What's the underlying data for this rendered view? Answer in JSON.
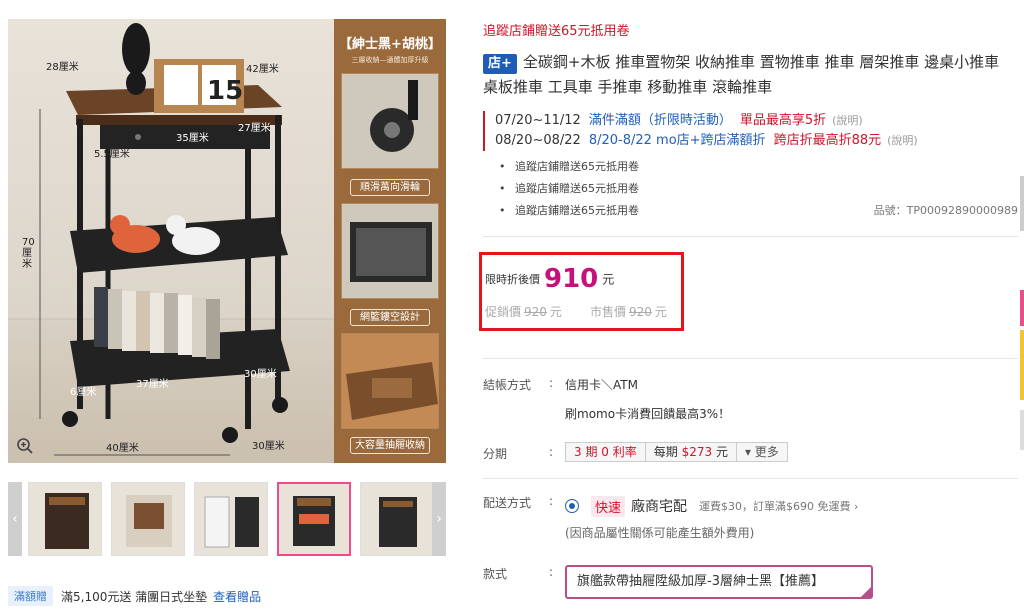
{
  "gallery": {
    "side_title": "【紳士黑+胡桃】",
    "side_subtitle": "三層收納—通體加厚升級",
    "side_labels": [
      "順滑萬向滑輪",
      "網籃鏤空設計",
      "大容量抽屜收納"
    ],
    "dimensions": {
      "top_left": "28厘米",
      "top_right": "42厘米",
      "drawer_w": "35厘米",
      "drawer_d": "27厘米",
      "drawer_h": "5.5厘米",
      "height": "70厘米",
      "wheel": "6厘米",
      "basket_w": "37厘米",
      "basket_d": "30厘米",
      "base_w": "40厘米",
      "base_d": "30厘米"
    },
    "zoom_icon": "zoom-in-icon",
    "prev_icon": "chevron-left-icon",
    "next_icon": "chevron-right-icon",
    "thumbnail_count": 5,
    "active_thumbnail": 4
  },
  "promo": {
    "tag": "滿額贈",
    "text": "滿5,100元送 蒲團日式坐墊",
    "link": "查看贈品"
  },
  "product": {
    "follow_text": "追蹤店鋪贈送65元抵用卷",
    "store_badge": "店+",
    "title": "全碳鋼+木板 推車置物架 收納推車 置物推車 推車 層架推車 邊桌小推車 桌板推車 工具車 手推車 移動推車 滾輪推車",
    "promotions": [
      {
        "date": "07/20~11/12",
        "text": "滿件滿額（折限時活動）",
        "highlight": "單品最高享5折",
        "note": "(說明)"
      },
      {
        "date": "08/20~08/22",
        "text": "8/20-8/22 mo店+跨店滿額折",
        "highlight": "跨店折最高折88元",
        "note": "(說明)"
      }
    ],
    "bullets": [
      "追蹤店鋪贈送65元抵用卷",
      "追蹤店鋪贈送65元抵用卷",
      "追蹤店鋪贈送65元抵用卷"
    ],
    "sku": "品號：TP00092890000989"
  },
  "price": {
    "label": "限時折後價",
    "value": "910",
    "unit": "元",
    "promo_label": "促銷價",
    "promo_value": "920",
    "market_label": "市售價",
    "market_value": "920"
  },
  "payment": {
    "label": "結帳方式",
    "colon": ":",
    "method": "信用卡＼ATM",
    "note": "刷momo卡消費回饋最高3%！"
  },
  "installment": {
    "label": "分期",
    "periods": "3 期 0 利率",
    "per_label": "每期",
    "per_amount": "$273",
    "per_unit": "元",
    "more": "▾ 更多"
  },
  "shipping": {
    "label": "配送方式",
    "quick": "快速",
    "name": "廠商宅配",
    "fee": "運費$30，訂單滿$690 免運費 ›",
    "note": "(因商品屬性關係可能產生額外費用)"
  },
  "style": {
    "label": "款式",
    "selected": "旗艦款帶抽屜陞級加厚-3層紳士黑【推薦】"
  },
  "colors": {
    "accent_red": "#d3122a",
    "price_magenta": "#c8107a",
    "link_blue": "#1f5fb8",
    "highlight_border": "#e3161d",
    "style_border": "#b74f8d"
  }
}
